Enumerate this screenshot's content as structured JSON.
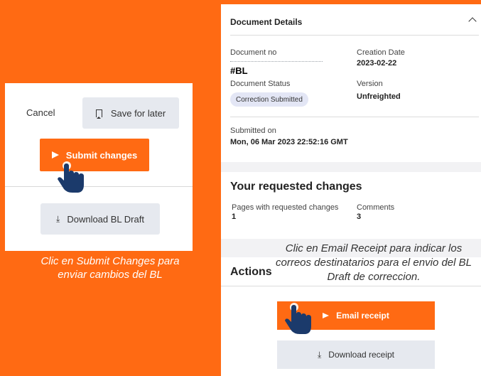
{
  "left_panel": {
    "cancel_label": "Cancel",
    "save_for_later_label": "Save for later",
    "submit_changes_label": "Submit changes",
    "download_bl_draft_label": "Download BL Draft",
    "caption": "Clic en Submit Changes para enviar cambios del BL"
  },
  "right_panel": {
    "document_details": {
      "title": "Document Details",
      "document_no_label": "Document no",
      "document_no_value": "#BL",
      "creation_date_label": "Creation Date",
      "creation_date_value": "2023-02-22",
      "document_status_label": "Document Status",
      "document_status_value": "Correction Submitted",
      "version_label": "Version",
      "version_value": "Unfreighted",
      "submitted_on_label": "Submitted on",
      "submitted_on_value": "Mon, 06 Mar 2023 22:52:16 GMT"
    },
    "requested_changes": {
      "title": "Your requested changes",
      "pages_label": "Pages with requested changes",
      "pages_value": "1",
      "comments_label": "Comments",
      "comments_value": "3"
    },
    "actions": {
      "title": "Actions",
      "email_receipt_label": "Email receipt",
      "download_receipt_label": "Download receipt"
    },
    "caption": "Clic en Email Receipt para indicar los correos destinatarios para el envio del BL Draft de correccion."
  },
  "colors": {
    "accent_orange": "#ff6a13",
    "cursor_navy": "#1b3a6b",
    "button_gray": "#e6e9ef"
  },
  "icons": [
    "bookmark-icon",
    "arrow-right-icon",
    "download-icon",
    "chevron-up-icon",
    "hand-pointer-icon"
  ]
}
